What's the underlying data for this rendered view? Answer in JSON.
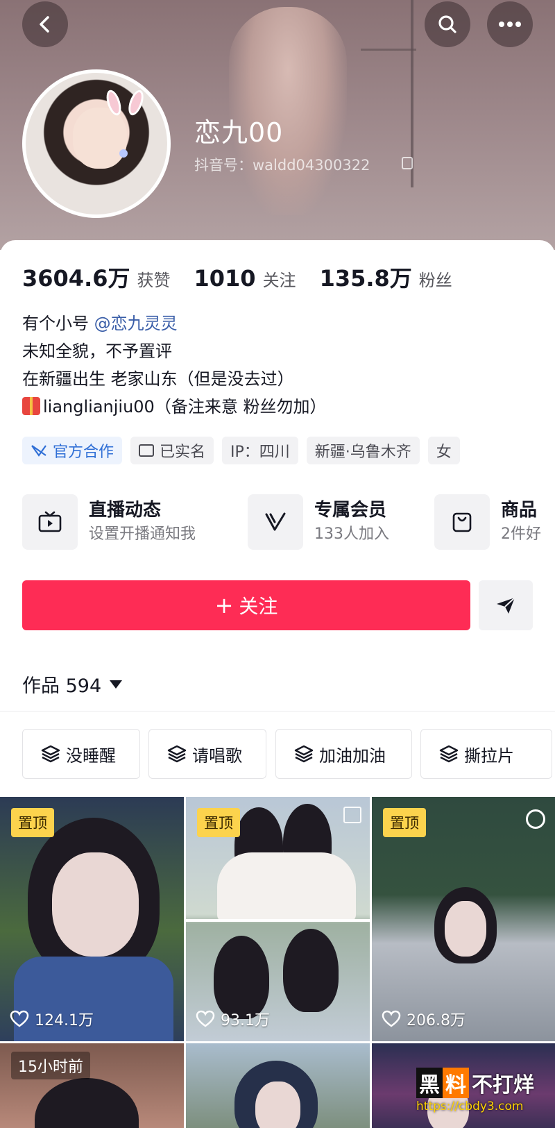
{
  "profile": {
    "nickname": "恋九00",
    "douyin_id": "抖音号：waldd04300322"
  },
  "stats": [
    {
      "value": "3604.6万",
      "label": "获赞"
    },
    {
      "value": "1010",
      "label": "关注"
    },
    {
      "value": "135.8万",
      "label": "粉丝"
    }
  ],
  "bio": {
    "line1_prefix": "有个小号",
    "line1_mention": "@恋九灵灵",
    "line2": "未知全貌，不予置评",
    "line3": "在新疆出生 老家山东（但是没去过）",
    "line4": "lianglianjiu00（备注来意 粉丝勿加）"
  },
  "tags": [
    "官方合作",
    "已实名",
    "IP：四川",
    "新疆·乌鲁木齐",
    "女"
  ],
  "features": [
    {
      "title": "直播动态",
      "sub": "设置开播通知我",
      "icon": "tv-icon"
    },
    {
      "title": "专属会员",
      "sub": "133人加入",
      "icon": "v-badge-icon"
    },
    {
      "title": "商品",
      "sub": "2件好",
      "icon": "shopping-bag-icon"
    }
  ],
  "actions": {
    "follow_label": "关注",
    "follow_color": "#fe2c55"
  },
  "works": {
    "label": "作品 594"
  },
  "collections": [
    "没睡醒",
    "请唱歌",
    "加油加油",
    "撕拉片"
  ],
  "videos": [
    {
      "badge": "置顶",
      "likes": "124.1万"
    },
    {
      "badge": "置顶",
      "likes": "93.1万"
    },
    {
      "badge": "置顶",
      "likes": "206.8万"
    },
    {
      "badge": "15小时前",
      "likes": ""
    },
    {
      "badge": "",
      "likes": ""
    },
    {
      "badge": "",
      "likes": ""
    }
  ],
  "watermark": {
    "hei": "黑",
    "liao": "料",
    "rest": "不打烊",
    "url": "https://cbdy3.com"
  }
}
